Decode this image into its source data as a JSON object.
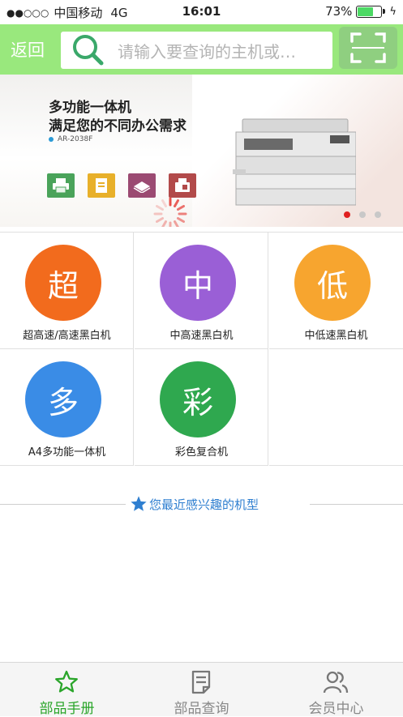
{
  "status": {
    "carrier": "中国移动",
    "network": "4G",
    "time": "16:01",
    "battery": "73%",
    "battery_level": 0.73
  },
  "header": {
    "back_label": "返回",
    "search_placeholder": "请输入要查询的主机或…"
  },
  "banner": {
    "headline1": "多功能一体机",
    "headline2": "满足您的不同办公需求",
    "model": "AR-2038F",
    "slide_count": 3,
    "active_slide": 0
  },
  "categories": [
    {
      "char": "超",
      "label": "超高速/高速黑白机",
      "color": "#f26b1d"
    },
    {
      "char": "中",
      "label": "中高速黑白机",
      "color": "#9a5fd6"
    },
    {
      "char": "低",
      "label": "中低速黑白机",
      "color": "#f7a52f"
    },
    {
      "char": "多",
      "label": "A4多功能一体机",
      "color": "#3a8ce6"
    },
    {
      "char": "彩",
      "label": "彩色复合机",
      "color": "#2fa84f"
    }
  ],
  "recent": {
    "label": "您最近感兴趣的机型"
  },
  "tabs": [
    {
      "label": "部品手册",
      "icon": "star-icon",
      "active": true
    },
    {
      "label": "部品查询",
      "icon": "document-icon",
      "active": false
    },
    {
      "label": "会员中心",
      "icon": "members-icon",
      "active": false
    }
  ],
  "colors": {
    "topbar": "#99e87d",
    "active_tab": "#2aa52a",
    "recent_text": "#2f7fd0",
    "active_dot": "#e02020"
  }
}
